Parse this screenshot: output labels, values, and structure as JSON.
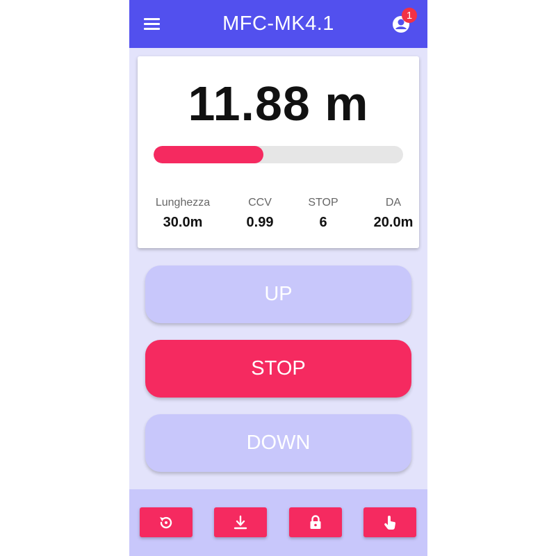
{
  "header": {
    "title": "MFC-MK4.1",
    "notification_count": "1",
    "menu_icon": "menu-icon",
    "user_icon": "user-icon"
  },
  "display": {
    "distance": "11.88 m",
    "progress_fraction": 0.44
  },
  "stats": [
    {
      "label": "Lunghezza",
      "value": "30.0m"
    },
    {
      "label": "CCV",
      "value": "0.99"
    },
    {
      "label": "STOP",
      "value": "6"
    },
    {
      "label": "DA",
      "value": "20.0m"
    }
  ],
  "controls": {
    "up_label": "UP",
    "stop_label": "STOP",
    "down_label": "DOWN"
  },
  "toolbar": {
    "icons": [
      "reset-icon",
      "download-icon",
      "lock-icon",
      "touch-icon"
    ]
  },
  "colors": {
    "primary": "#5250ee",
    "accent": "#f52a60",
    "button_light": "#c8c7fb",
    "background": "#e3e3fb",
    "badge": "#f23145"
  }
}
